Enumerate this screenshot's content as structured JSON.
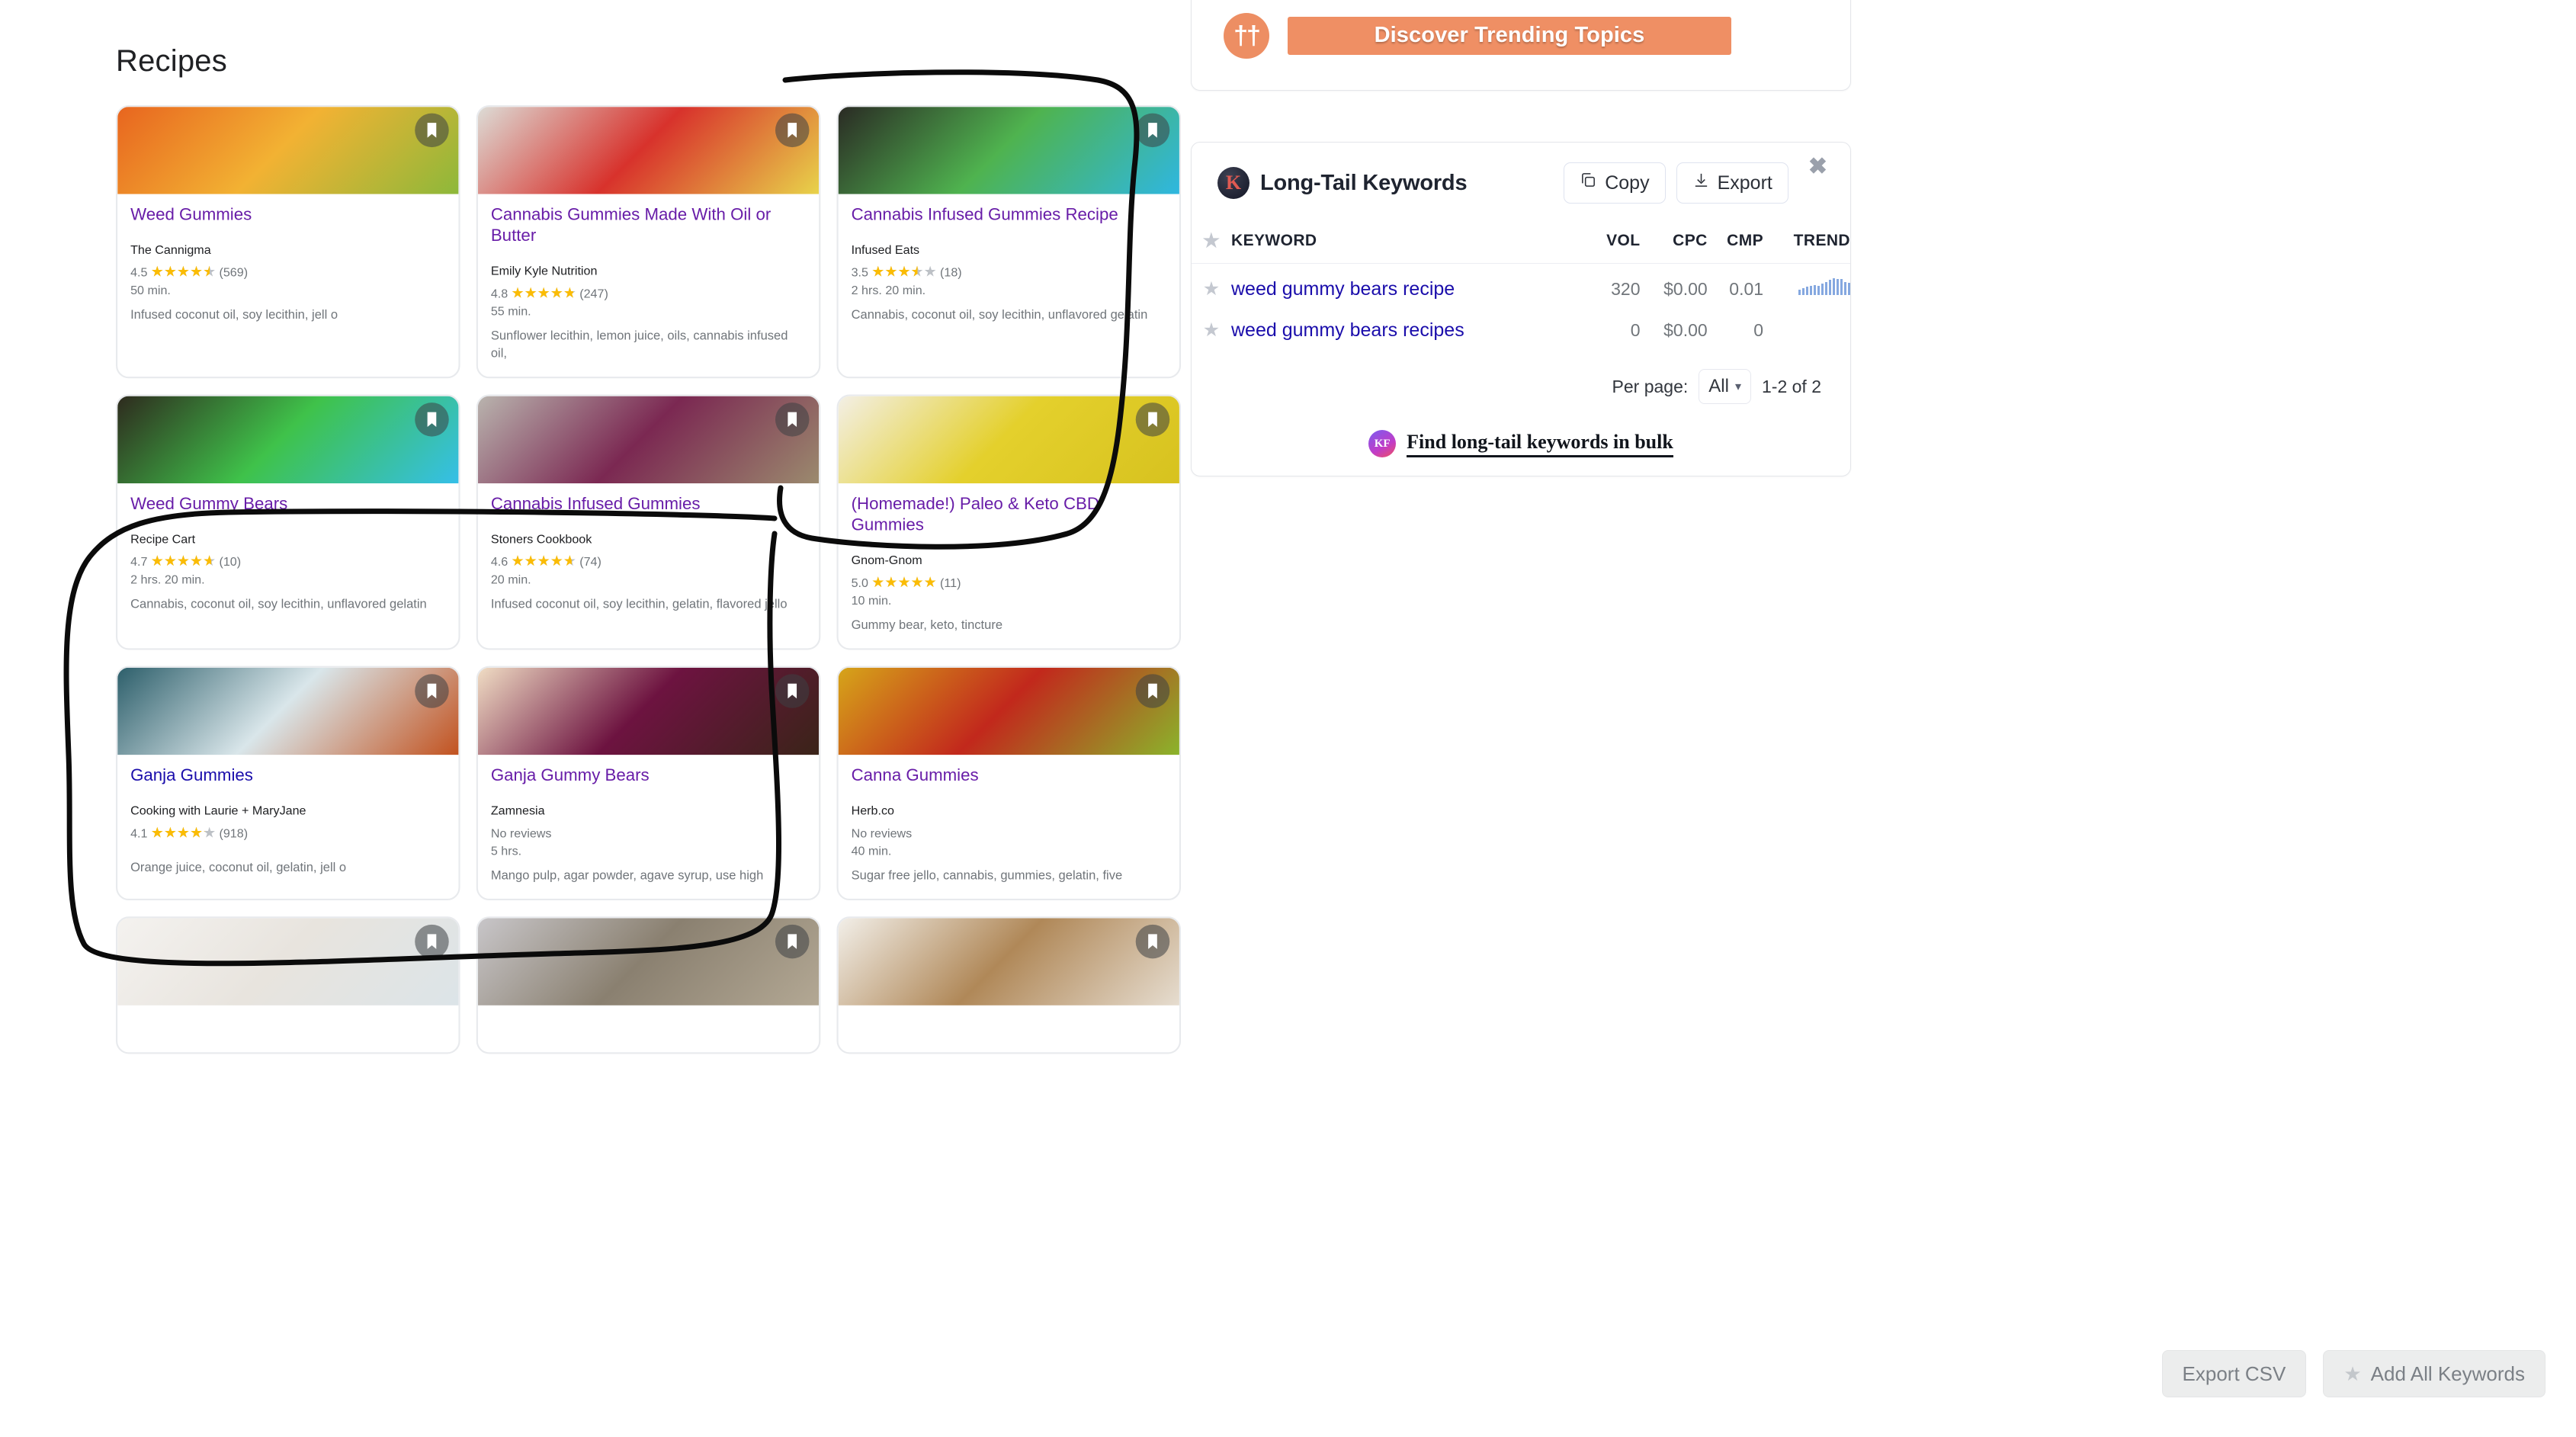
{
  "recipes": {
    "heading": "Recipes",
    "cards": [
      {
        "title": "Weed Gummies",
        "site": "The Cannigma",
        "rating": "4.5",
        "rating_pct": 90,
        "reviews": "(569)",
        "time": "50 min.",
        "ingredients": "Infused coconut oil, soy lecithin, jell o",
        "link_state": "visited",
        "img_a": "#e8651f",
        "img_b": "#f2b233",
        "img_c": "#8db83a"
      },
      {
        "title": "Cannabis Gummies Made With Oil or Butter",
        "site": "Emily Kyle Nutrition",
        "rating": "4.8",
        "rating_pct": 96,
        "reviews": "(247)",
        "time": "55 min.",
        "ingredients": "Sunflower lecithin, lemon juice, oils, cannabis infused oil,",
        "link_state": "visited",
        "img_a": "#dcdcd6",
        "img_b": "#d8322c",
        "img_c": "#e8d34a"
      },
      {
        "title": "Cannabis Infused Gummies Recipe",
        "site": "Infused Eats",
        "rating": "3.5",
        "rating_pct": 70,
        "reviews": "(18)",
        "time": "2 hrs. 20 min.",
        "ingredients": "Cannabis, coconut oil, soy lecithin, unflavored gelatin",
        "link_state": "visited",
        "img_a": "#2a2a24",
        "img_b": "#4fb34f",
        "img_c": "#2fb7e0"
      },
      {
        "title": "Weed Gummy Bears",
        "site": "Recipe Cart",
        "rating": "4.7",
        "rating_pct": 94,
        "reviews": "(10)",
        "time": "2 hrs. 20 min.",
        "ingredients": "Cannabis, coconut oil, soy lecithin, unflavored gelatin",
        "link_state": "visited",
        "img_a": "#2e2a1e",
        "img_b": "#3fc24a",
        "img_c": "#35bfe8"
      },
      {
        "title": "Cannabis Infused Gummies",
        "site": "Stoners Cookbook",
        "rating": "4.6",
        "rating_pct": 92,
        "reviews": "(74)",
        "time": "20 min.",
        "ingredients": "Infused coconut oil, soy lecithin, gelatin, flavored jello",
        "link_state": "visited",
        "img_a": "#b9b4ae",
        "img_b": "#7b2852",
        "img_c": "#9b8a6e"
      },
      {
        "title": "(Homemade!) Paleo & Keto CBD Gummies",
        "site": "Gnom-Gnom",
        "rating": "5.0",
        "rating_pct": 100,
        "reviews": "(11)",
        "time": "10 min.",
        "ingredients": "Gummy bear, keto, tincture",
        "link_state": "visited",
        "img_a": "#f3efe6",
        "img_b": "#e4d02c",
        "img_c": "#d7c21f"
      },
      {
        "title": "Ganja Gummies",
        "site": "Cooking with Laurie + MaryJane",
        "rating": "4.1",
        "rating_pct": 82,
        "reviews": "(918)",
        "time": "",
        "ingredients": "Orange juice, coconut oil, gelatin, jell o",
        "link_state": "unvisited",
        "img_a": "#2d5f6b",
        "img_b": "#d9e6ea",
        "img_c": "#c2521f"
      },
      {
        "title": "Ganja Gummy Bears",
        "site": "Zamnesia",
        "rating": "",
        "rating_pct": 0,
        "reviews": "No reviews",
        "time": "5 hrs.",
        "ingredients": "Mango pulp, agar powder, agave syrup, use high",
        "link_state": "visited",
        "img_a": "#f0ddc4",
        "img_b": "#6d1340",
        "img_c": "#3a2418"
      },
      {
        "title": "Canna Gummies",
        "site": "Herb.co",
        "rating": "",
        "rating_pct": 0,
        "reviews": "No reviews",
        "time": "40 min.",
        "ingredients": "Sugar free jello, cannabis, gummies, gelatin, five",
        "link_state": "visited",
        "img_a": "#d6a51a",
        "img_b": "#c2281c",
        "img_c": "#8bb42b"
      },
      {
        "title": "",
        "site": "",
        "rating": "",
        "rating_pct": 0,
        "reviews": "",
        "time": "",
        "ingredients": "",
        "link_state": "visited",
        "img_a": "#f4f2ef",
        "img_b": "#e8e4de",
        "img_c": "#dce4e8"
      },
      {
        "title": "",
        "site": "",
        "rating": "",
        "rating_pct": 0,
        "reviews": "",
        "time": "",
        "ingredients": "",
        "link_state": "visited",
        "img_a": "#c8c6c9",
        "img_b": "#8a8070",
        "img_c": "#b3a894"
      },
      {
        "title": "",
        "site": "",
        "rating": "",
        "rating_pct": 0,
        "reviews": "",
        "time": "",
        "ingredients": "",
        "link_state": "visited",
        "img_a": "#f2efe9",
        "img_b": "#b08858",
        "img_c": "#e6ddd0"
      }
    ]
  },
  "trending_banner": {
    "icon_glyph": "††",
    "button_label": "Discover Trending Topics",
    "accent_color": "#ef8f64"
  },
  "keywords_panel": {
    "logo_letter": "K",
    "title": "Long-Tail Keywords",
    "copy_label": "Copy",
    "export_label": "Export",
    "close_glyph": "✖",
    "columns": [
      "KEYWORD",
      "VOL",
      "CPC",
      "CMP",
      "TREND"
    ],
    "rows": [
      {
        "keyword": "weed gummy bears recipe",
        "vol": "320",
        "cpc": "$0.00",
        "cmp": "0.01",
        "trend": [
          30,
          38,
          45,
          50,
          55,
          48,
          60,
          68,
          82,
          90,
          86,
          84,
          70,
          66
        ]
      },
      {
        "keyword": "weed gummy bears recipes",
        "vol": "0",
        "cpc": "$0.00",
        "cmp": "0",
        "trend": []
      }
    ],
    "per_page_label": "Per page:",
    "per_page_value": "All",
    "range_label": "1-2 of 2",
    "bulk_logo_letter": "KF",
    "bulk_link_label": "Find long-tail keywords in bulk"
  },
  "bottom_actions": {
    "export_csv_label": "Export CSV",
    "add_all_label": "Add All Keywords",
    "add_all_star": "★"
  }
}
